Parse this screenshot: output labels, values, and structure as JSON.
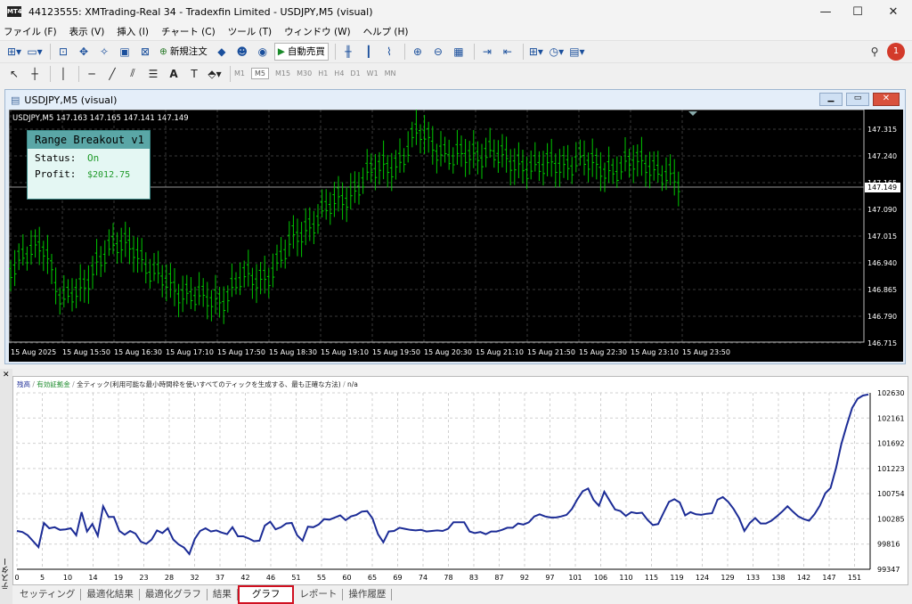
{
  "window": {
    "title": "44123555: XMTrading-Real 34 - Tradexfin Limited - USDJPY,M5 (visual)",
    "app_icon": "MT4",
    "minimize": "—",
    "maximize": "☐",
    "close": "✕"
  },
  "menu": [
    "ファイル (F)",
    "表示 (V)",
    "挿入 (I)",
    "チャート (C)",
    "ツール (T)",
    "ウィンドウ (W)",
    "ヘルプ (H)"
  ],
  "toolbar1": {
    "new_order": "新規注文",
    "auto_trade": "自動売買",
    "notif_count": "1"
  },
  "timeframes": [
    "M1",
    "M5",
    "M15",
    "M30",
    "H1",
    "H4",
    "D1",
    "W1",
    "MN"
  ],
  "active_timeframe": "M5",
  "chart_window": {
    "title": "USDJPY,M5 (visual)",
    "symbol_info": "USDJPY,M5  147.163 147.165 147.141 147.149",
    "current_price": "147.149",
    "price_labels": [
      "147.315",
      "147.240",
      "147.165",
      "147.090",
      "147.015",
      "146.940",
      "146.865",
      "146.790",
      "146.715"
    ],
    "time_labels": [
      "15 Aug 2025",
      "15 Aug 15:50",
      "15 Aug 16:30",
      "15 Aug 17:10",
      "15 Aug 17:50",
      "15 Aug 18:30",
      "15 Aug 19:10",
      "15 Aug 19:50",
      "15 Aug 20:30",
      "15 Aug 21:10",
      "15 Aug 21:50",
      "15 Aug 22:30",
      "15 Aug 23:10",
      "15 Aug 23:50"
    ]
  },
  "ea_panel": {
    "name": "Range Breakout v1",
    "status_label": "Status:",
    "status_value": "On",
    "profit_label": "Profit:",
    "profit_value": "$2012.75"
  },
  "tester": {
    "side_label": "テスター",
    "legend": {
      "balance": "残高",
      "margin": "有効証拠金",
      "model": "全ティック(利用可能な最小時間枠を使いすべてのティックを生成する、最も正確な方法)",
      "sep": " / ",
      "na": "n/a"
    },
    "tabs": [
      "セッティング",
      "最適化結果",
      "最適化グラフ",
      "結果",
      "グラフ",
      "レポート",
      "操作履歴"
    ],
    "active_tab": "グラフ"
  },
  "colors": {
    "candle": "#00c800",
    "balance_line": "#1c2c96",
    "highlight": "#d01020"
  },
  "chart_data": [
    {
      "type": "line",
      "title": "",
      "series": [
        {
          "name": "残高",
          "values": [
            100060,
            100040,
            99980,
            99870,
            99760,
            100210,
            100110,
            100130,
            100080,
            100090,
            100110,
            99980,
            100410,
            100050,
            100190,
            99970,
            100520,
            100320,
            100320,
            100060,
            99990,
            100060,
            100010,
            99860,
            99820,
            99900,
            100070,
            100020,
            100110,
            99900,
            99810,
            99750,
            99630,
            99910,
            100060,
            100110,
            100050,
            100070,
            100030,
            100000,
            100130,
            99960,
            99960,
            99920,
            99870,
            99880,
            100160,
            100230,
            100090,
            100130,
            100200,
            100210,
            99980,
            99880,
            100140,
            100130,
            100180,
            100280,
            100270,
            100310,
            100350,
            100260,
            100330,
            100360,
            100420,
            100430,
            100290,
            100000,
            99850,
            100050,
            100060,
            100120,
            100100,
            100080,
            100070,
            100080,
            100050,
            100060,
            100070,
            100060,
            100100,
            100220,
            100220,
            100220,
            100050,
            100020,
            100040,
            100000,
            100050,
            100050,
            100080,
            100120,
            100120,
            100200,
            100180,
            100220,
            100330,
            100370,
            100330,
            100310,
            100310,
            100330,
            100360,
            100470,
            100650,
            100800,
            100850,
            100640,
            100530,
            100790,
            100620,
            100460,
            100430,
            100340,
            100410,
            100390,
            100400,
            100270,
            100170,
            100190,
            100400,
            100600,
            100650,
            100590,
            100350,
            100410,
            100370,
            100360,
            100380,
            100390,
            100640,
            100690,
            100600,
            100470,
            100300,
            100060,
            100210,
            100300,
            100200,
            100200,
            100250,
            100330,
            100420,
            100520,
            100420,
            100330,
            100280,
            100250,
            100370,
            100530,
            100760,
            100860,
            101230,
            101680,
            102030,
            102350,
            102520,
            102580,
            102600
          ]
        }
      ],
      "x": [
        0,
        5,
        10,
        14,
        19,
        23,
        28,
        32,
        37,
        42,
        46,
        51,
        55,
        60,
        65,
        69,
        74,
        78,
        83,
        87,
        92,
        97,
        101,
        106,
        110,
        115,
        119,
        124,
        129,
        133,
        138,
        142,
        147,
        151
      ],
      "ylim": [
        99347,
        102630
      ],
      "yticks": [
        "102630",
        "102161",
        "101692",
        "101223",
        "100754",
        "100285",
        "99816",
        "99347"
      ]
    },
    {
      "type": "candlestick",
      "title": "",
      "ylim": [
        146.715,
        147.315
      ],
      "price": 147.149
    }
  ]
}
